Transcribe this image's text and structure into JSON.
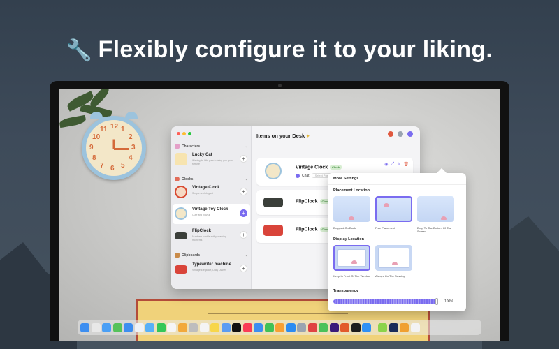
{
  "headline": {
    "icon": "wrench-icon",
    "text": "Flexibly configure it to your liking."
  },
  "app": {
    "main_title": "Items on your Desk",
    "sections": [
      {
        "label": "Characters",
        "icon": "characters-icon"
      },
      {
        "label": "Clocks",
        "icon": "clock-section-icon"
      },
      {
        "label": "Clipboards",
        "icon": "clipboard-section-icon"
      }
    ],
    "items": [
      {
        "title": "Lucky Cat",
        "sub": "Waving its little paw to bring you good fortune",
        "plus": "+"
      },
      {
        "title": "Vintage Clock",
        "sub": "Simple and elegant",
        "plus": "+"
      },
      {
        "title": "Vintage Toy Clock",
        "sub": "Cute and playful",
        "plus": "+"
      },
      {
        "title": "FlipClock",
        "sub": "Numbers tumble softly, marking moments",
        "plus": "+"
      },
      {
        "title": "Typewriter machine",
        "sub": "Vintage Elegance, Daily Diaries",
        "plus": "+"
      }
    ],
    "cards": [
      {
        "name": "Vintage Clock",
        "badge": "Clock",
        "chat_label": "Chat",
        "select_placeholder": "Select Position"
      },
      {
        "name": "FlipClock",
        "badge": "Clock"
      },
      {
        "name": "FlipClock",
        "badge": "Clock"
      }
    ],
    "popup": {
      "title": "More Settings",
      "placement_heading": "Placement Location",
      "placement_options": [
        "Dropped On Dock",
        "Free Placement",
        "Drop To The Bottom Of The Screen"
      ],
      "display_heading": "Display Location",
      "display_options": [
        "Keep In Front Of The Window",
        "Always On The Desktop"
      ],
      "transparency_heading": "Transparency",
      "transparency_value": "100%",
      "transparency_fraction": 1.0
    }
  },
  "wall_clock_numbers": [
    "12",
    "1",
    "2",
    "3",
    "4",
    "5",
    "6",
    "7",
    "8",
    "9",
    "10",
    "11"
  ],
  "colors": {
    "accent": "#7a6cf0",
    "clock_face": "#f3e7c8",
    "clock_rim": "#9cc3dd"
  }
}
